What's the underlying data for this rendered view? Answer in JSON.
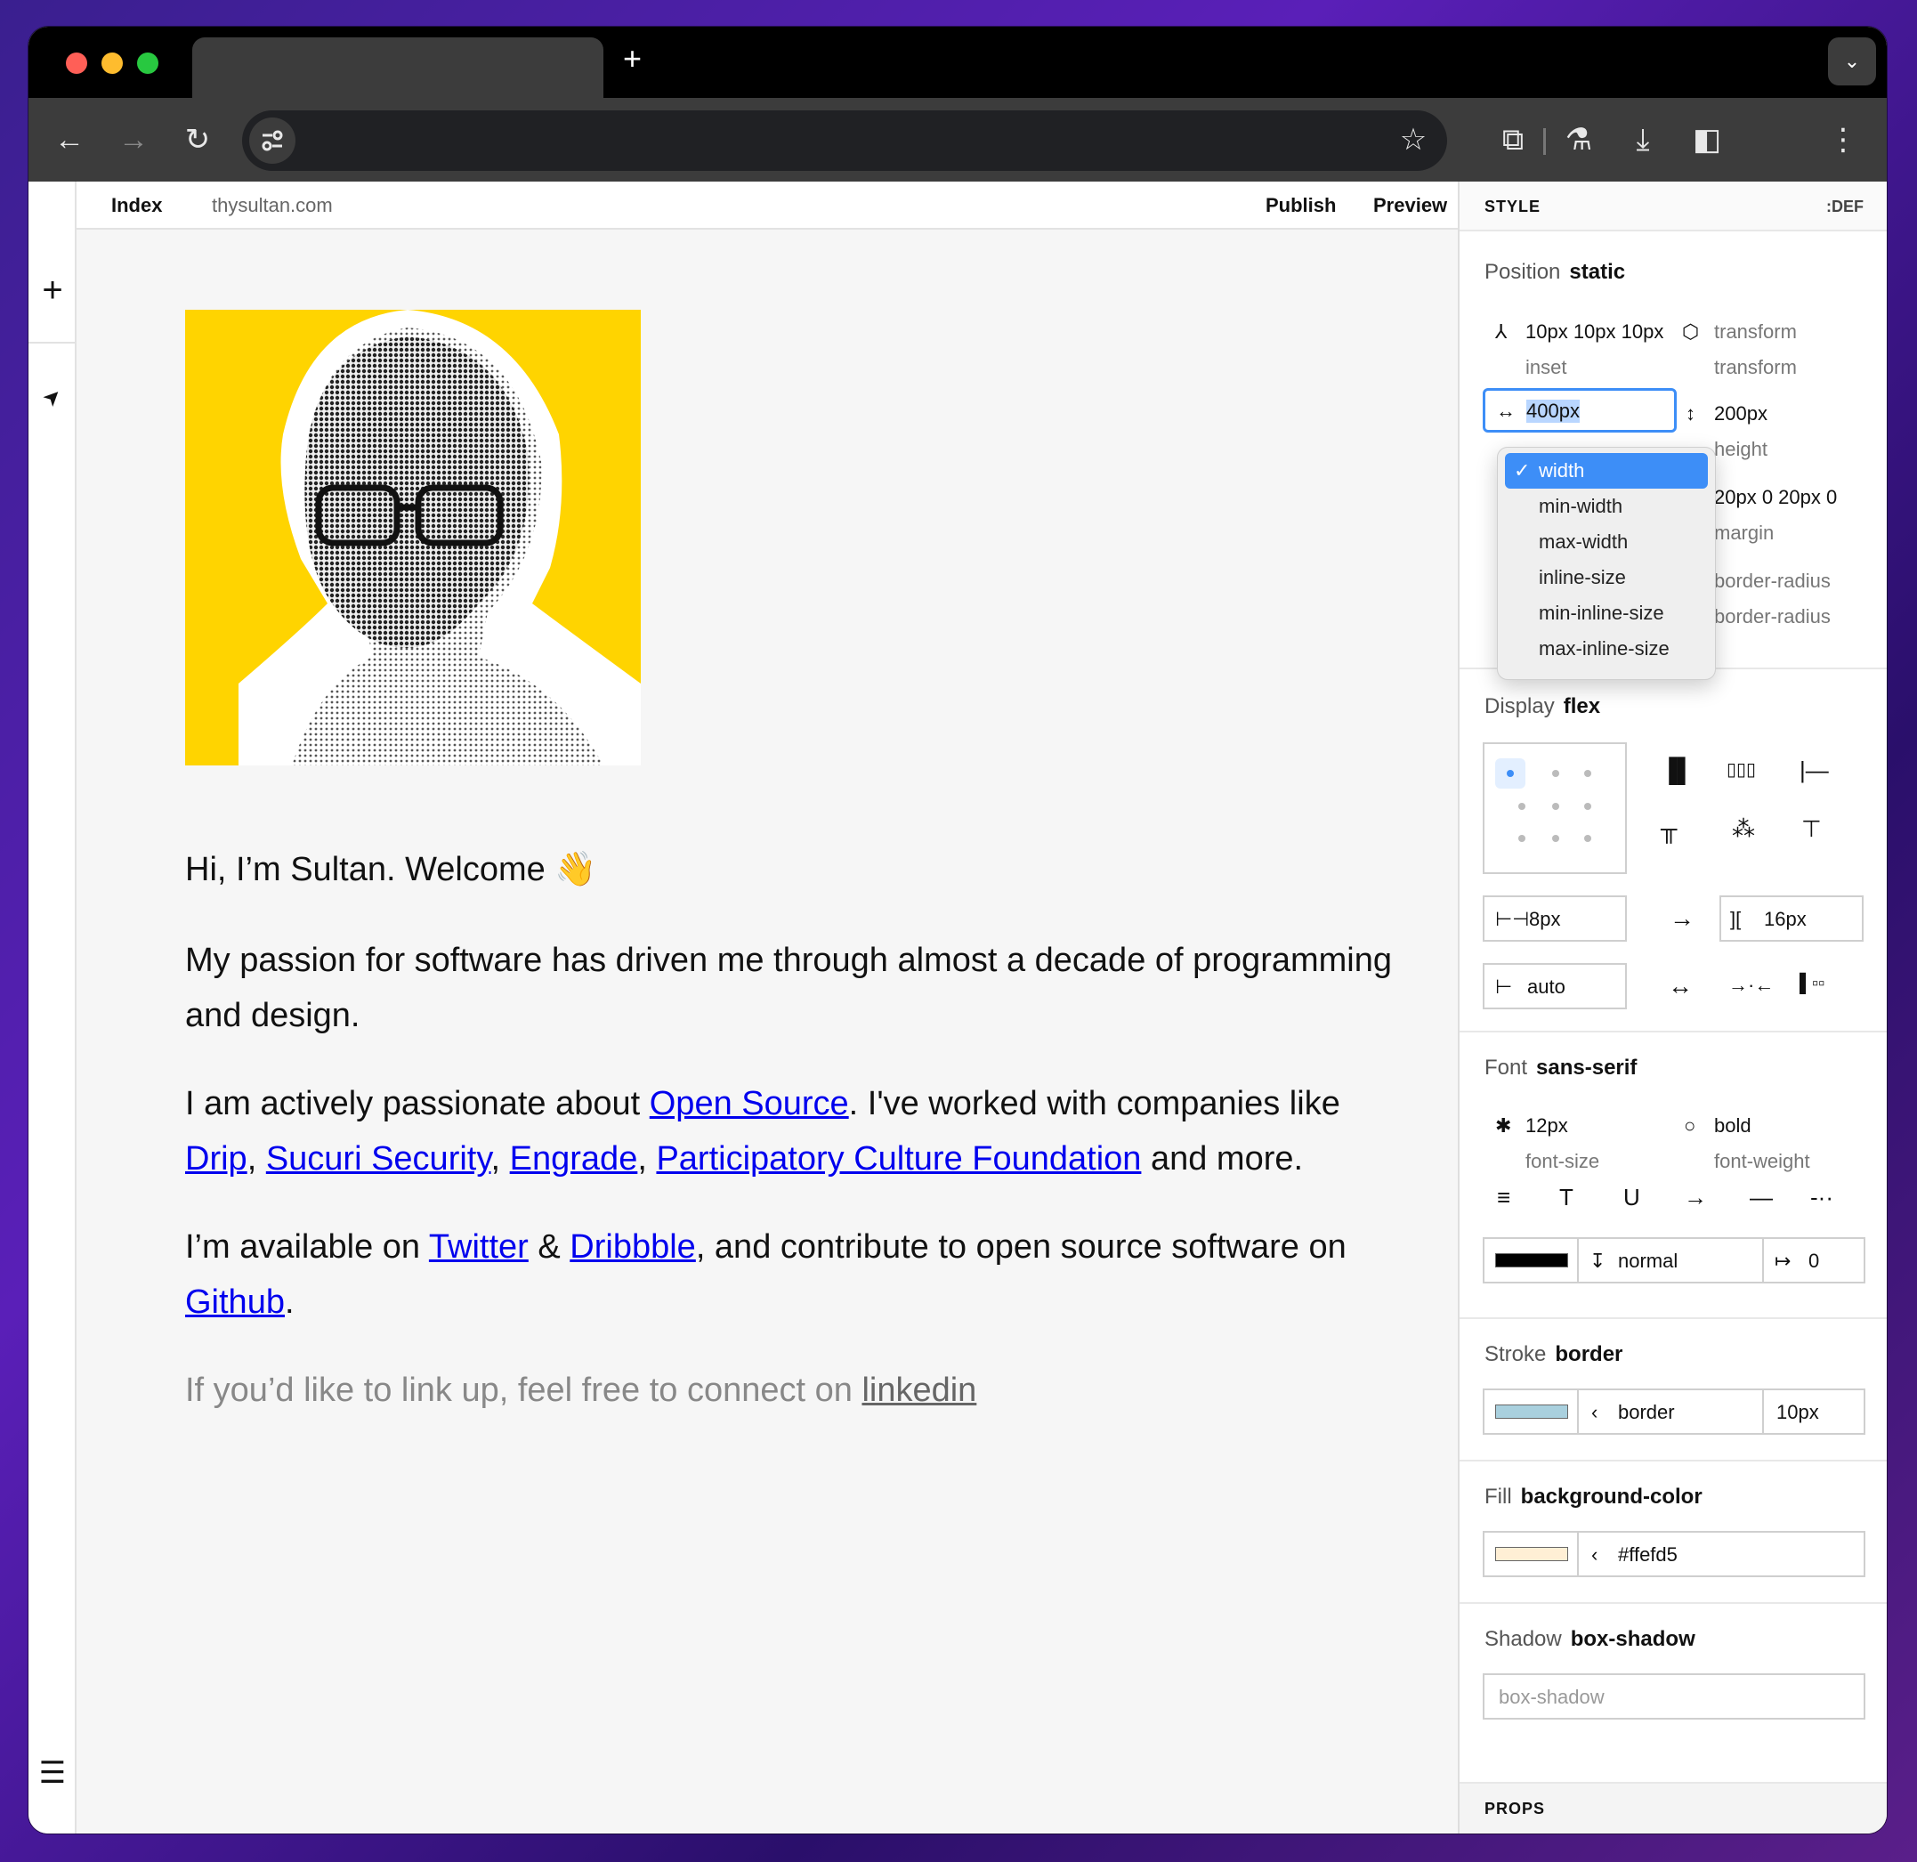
{
  "browser": {
    "new_tab": "+",
    "menu": "⌄"
  },
  "toolbar": {
    "back": "←",
    "forward": "→",
    "reload": "↻",
    "star": "☆",
    "ext": "⧉",
    "lab": "⚗",
    "download": "⤓",
    "sidebar": "◧",
    "more": "⋮"
  },
  "editor": {
    "page_title": "Index",
    "site": "thysultan.com",
    "publish": "Publish",
    "preview": "Preview",
    "add": "+",
    "navigate": "➤",
    "menu": "☰"
  },
  "content": {
    "greeting": "Hi, I’m Sultan. Welcome",
    "wave": "👋",
    "p1": "My passion for software has driven me through almost a decade of programming and design.",
    "p2_pre": "I am actively passionate about ",
    "p2_link": "Open Source",
    "p2_mid": ". I've worked with companies like",
    "p2_drip": "Drip",
    "p2_sucuri": "Sucuri Security",
    "p2_engrade": "Engrade",
    "p2_pcf": "Participatory Culture Foundation",
    "p2_post": " and more.",
    "p3_pre": "I’m available on ",
    "p3_twitter": "Twitter",
    "p3_amp": " & ",
    "p3_dribbble": "Dribbble",
    "p3_mid": ", and contribute to open source software on ",
    "p3_github": "Github",
    "p3_post": ".",
    "p4_pre": "If you’d like to link up, feel free to connect on ",
    "p4_link": "linkedin"
  },
  "panel": {
    "header": "STYLE",
    "def": ":DEF",
    "position_label": "Position",
    "position_value": "static",
    "inset_value": "10px 10px 10px",
    "inset_label": "inset",
    "transform_value": "transform",
    "transform_label": "transform",
    "width_value": "400px",
    "height_value": "200px",
    "height_label": "height",
    "margin_value": "20px 0 20px 0",
    "margin_label": "margin",
    "radius_value": "border-radius",
    "radius_label": "border-radius",
    "display_label": "Display",
    "display_value": "flex",
    "gap_value": "8px",
    "gap2_value": "16px",
    "basis_value": "auto",
    "font_label": "Font",
    "font_value": "sans-serif",
    "font_size_value": "12px",
    "font_size_label": "font-size",
    "font_weight_value": "bold",
    "font_weight_label": "font-weight",
    "line_height_value": "normal",
    "letter_spacing_value": "0",
    "stroke_label": "Stroke",
    "stroke_value": "border",
    "stroke_style": "border",
    "stroke_width": "10px",
    "fill_label": "Fill",
    "fill_value": "background-color",
    "fill_color": "#ffefd5",
    "shadow_label": "Shadow",
    "shadow_value": "box-shadow",
    "shadow_placeholder": "box-shadow",
    "props": "PROPS"
  },
  "dropdown": {
    "items": [
      "width",
      "min-width",
      "max-width",
      "inline-size",
      "min-inline-size",
      "max-inline-size"
    ],
    "selected": "width"
  },
  "colors": {
    "accent": "#3d8ef7",
    "link": "#0000ee",
    "photo_bg": "#ffd400",
    "stroke_swatch": "#a9d0de",
    "fill_swatch": "#ffefd5",
    "text_color": "#000000"
  }
}
